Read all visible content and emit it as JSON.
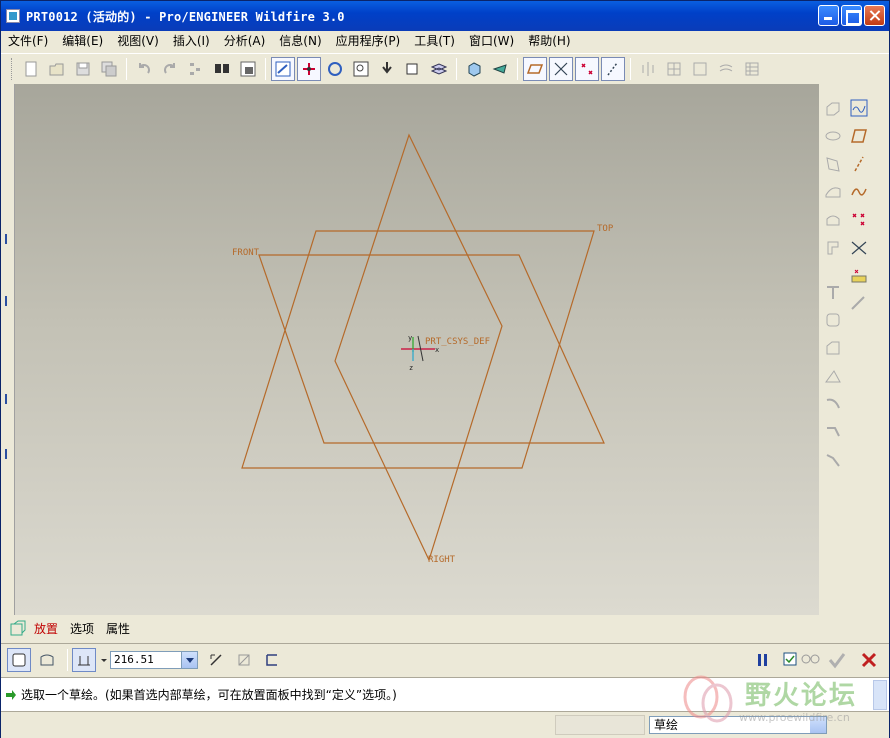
{
  "window": {
    "title": "PRT0012 (活动的) - Pro/ENGINEER Wildfire 3.0"
  },
  "menu": {
    "items": [
      "文件(F)",
      "编辑(E)",
      "视图(V)",
      "插入(I)",
      "分析(A)",
      "信息(N)",
      "应用程序(P)",
      "工具(T)",
      "窗口(W)",
      "帮助(H)"
    ]
  },
  "toolbar": {
    "icons": [
      "new-icon",
      "open-icon",
      "save-icon",
      "save-copy-icon",
      "undo-icon",
      "redo-icon",
      "regenerate-icon",
      "find-icon",
      "view-manager-icon",
      "repaint-icon",
      "spin-center-icon",
      "orient-icon",
      "zoom-in-icon",
      "reorient-icon",
      "saved-views-icon",
      "layers-icon",
      "shading-icon",
      "model-display-icon",
      "datum-planes-icon",
      "datum-axes-icon",
      "datum-points-icon",
      "coord-sys-icon"
    ]
  },
  "viewport": {
    "labels": {
      "front": "FRONT",
      "top": "TOP",
      "right": "RIGHT",
      "csys": "PRT_CSYS_DEF",
      "axis_x": "x",
      "axis_y": "y",
      "axis_z": "z"
    },
    "datum_color": "#b56a2a"
  },
  "dashboard": {
    "tabs": [
      "放置",
      "选项",
      "属性"
    ],
    "depth_value": "216.51"
  },
  "message": {
    "text": "选取一个草绘。(如果首选内部草绘，可在放置面板中找到“定义”选项。)"
  },
  "status": {
    "filter": "草绘"
  },
  "watermark": {
    "title": "野火论坛",
    "url": "www.proewildfire.cn"
  }
}
